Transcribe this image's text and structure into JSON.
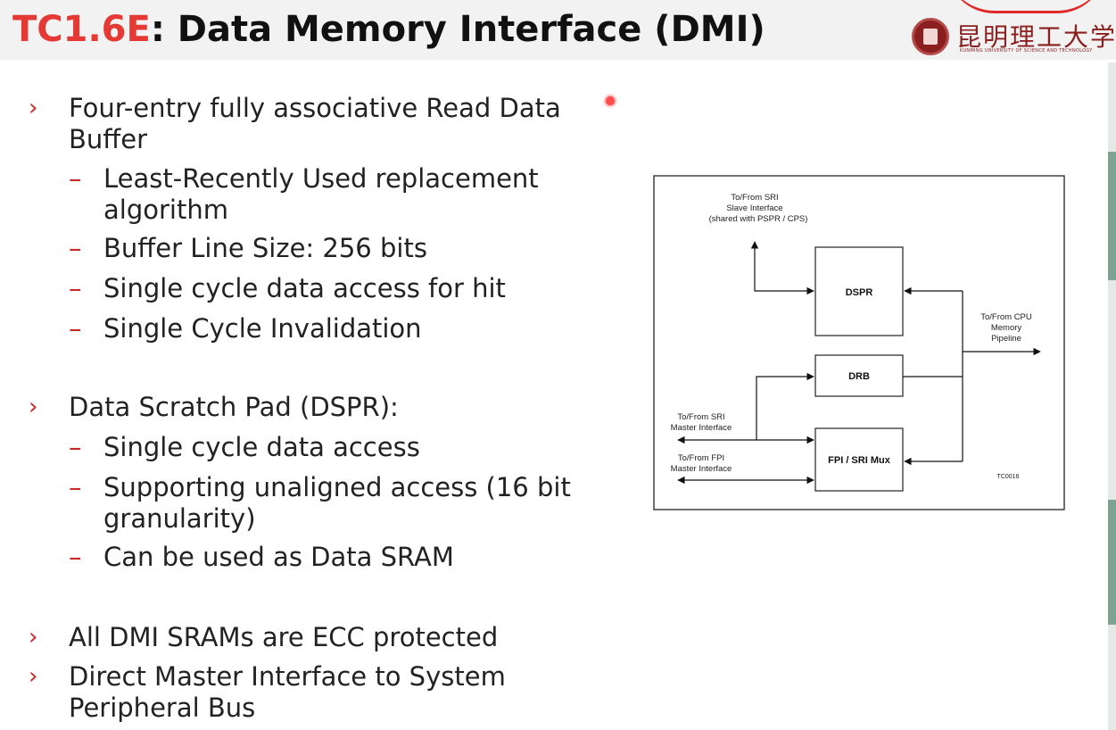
{
  "header": {
    "title_accent": "TC1.6E",
    "title_rest": ": Data Memory Interface (DMI)",
    "logo_cn": "昆明理工大学",
    "logo_en": "KUNMING UNIVERSITY OF SCIENCE AND TECHNOLOGY"
  },
  "bullets": [
    {
      "marker": "›",
      "text": "Four-entry fully associative Read Data Buffer",
      "subitems": [
        "Least-Recently Used replacement algorithm",
        "Buffer Line Size: 256 bits",
        "Single cycle data access for hit",
        "Single Cycle Invalidation"
      ]
    },
    {
      "marker": "›",
      "text": "Data Scratch Pad (DSPR):",
      "subitems": [
        "Single cycle data access",
        "Supporting unaligned access (16 bit granularity)",
        "Can be used as Data SRAM"
      ]
    },
    {
      "marker": "›",
      "text": "All DMI SRAMs are ECC protected",
      "subitems": []
    },
    {
      "marker": "›",
      "text": "Direct Master Interface to System Peripheral Bus",
      "subitems": []
    }
  ],
  "sub_marker": "–",
  "diagram": {
    "sri_slave_line1": "To/From SRI",
    "sri_slave_line2": "Slave Interface",
    "sri_slave_line3": "(shared with PSPR / CPS)",
    "cpu_line1": "To/From CPU",
    "cpu_line2": "Memory",
    "cpu_line3": "Pipeline",
    "sri_master_line1": "To/From SRI",
    "sri_master_line2": "Master Interface",
    "fpi_master_line1": "To/From FPI",
    "fpi_master_line2": "Master Interface",
    "box_dspr": "DSPR",
    "box_drb": "DRB",
    "box_mux": "FPI / SRI Mux",
    "figure_id": "TC0016"
  },
  "colors": {
    "accent": "#e53935",
    "marker": "#c62828",
    "text": "#222222"
  }
}
